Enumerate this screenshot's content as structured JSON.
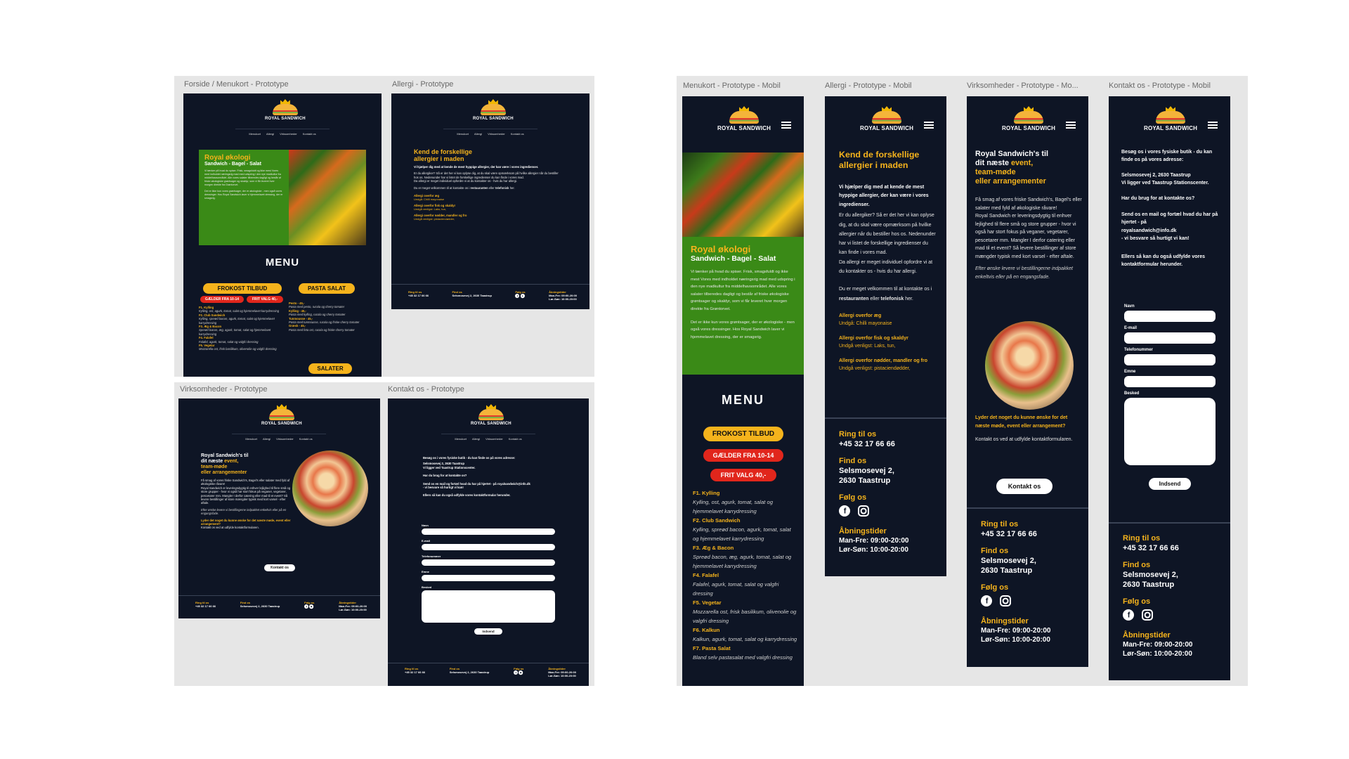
{
  "frames": {
    "desk_forside": "Forside / Menukort - Prototype",
    "desk_allergi": "Allergi - Prototype",
    "desk_virk": "Virksomheder - Prototype",
    "desk_kontakt": "Kontakt os - Prototype",
    "mob_menu": "Menukort - Prototype - Mobil",
    "mob_allergi": "Allergi - Prototype - Mobil",
    "mob_virk": "Virksomheder - Prototype - Mo...",
    "mob_kontakt": "Kontakt os - Prototype - Mobil"
  },
  "brand": {
    "name": "ROYAL SANDWICH",
    "tagline": "Taastrup"
  },
  "nav": [
    "Menukort",
    "Allergi",
    "Virksomheder",
    "Kontakt os"
  ],
  "hero": {
    "title": "Royal økologi",
    "subtitle": "Sandwich - Bagel - Salat",
    "p1": "Vi tænker på hvad du spiser. Frisk, smagsfuldt og ikke mest Vores med indholdet næringsrig mad med udspring i den nye madkultur fra middelhavsområdet. Alle vores salater tilberedes dagligt og består af friske økologiske grøntsager og skaldyr, som vi får leveret hver morgen direkte fra Grøntorvet.",
    "p2": "Det er ikke kun vores grøntsager, der er økologiske - men også vores dressinger. Hos Royal Sandwich laver vi hjemmelavet dressing, der er smagsrig."
  },
  "menu": {
    "title": "MENU",
    "breakfast": "FROKOST TILBUD",
    "valid": "GÆLDER FRA 10-14",
    "choice": "FRIT VALG 40,-",
    "pasta_btn": "PASTA SALAT",
    "salads_btn": "SALATER",
    "items": [
      {
        "name": "F1. Kylling",
        "desc": "Kylling, ost, agurk, tomat, salat og hjemmelavet karrydressing"
      },
      {
        "name": "F2. Club Sandwich",
        "desc": "Kylling, spreød bacon, agurk, tomat, salat og hjemmelavet karrydressing"
      },
      {
        "name": "F3. Æg & Bacon",
        "desc": "Spreød bacon, æg, agurk, tomat, salat og hjemmelavet karrydressing"
      },
      {
        "name": "F4. Falafel",
        "desc": "Falafel, agurk, tomat, salat og valgfri dressing"
      },
      {
        "name": "F5. Vegetar",
        "desc": "Mozzarella ost, frisk basilikum, olivenolie og valgfri dressing"
      },
      {
        "name": "F6. Kalkun",
        "desc": "Kalkun, agurk, tomat, salat og karrydressing"
      },
      {
        "name": "F7. Pasta Salat",
        "desc": "Bland selv pastasalat med valgfri dressing"
      }
    ],
    "pasta": [
      {
        "name": "Pesto - 45,-",
        "desc": "Pasta med pesto, rucola og cherry tomater"
      },
      {
        "name": "Kylling - 45,-",
        "desc": "Pasta med kylling, rucola og cherry tomater"
      },
      {
        "name": "Tunmousse - 45,-",
        "desc": "Pasta med tunmousse, rucola og friske cherry tomater"
      },
      {
        "name": "Græsk - 45,-",
        "desc": "Pasta med feta ost, rucola og friske cherry tomater"
      }
    ]
  },
  "allergi": {
    "title_a": "Kend de forskellige",
    "title_b": "allergier i maden",
    "lead": "Vi hjælper dig med at kende de mest hyppige allergier, der kan være i vores ingredienser.",
    "p1": "Er du allergiker? Så er det her vi kan oplyse dig, at du skal være opmærksom på hvilke allergier når du bestiller hos os. Nedenunder har vi listet de forskellige ingredienser du kan finde i vores mad.",
    "p2": "Da allergi er meget individuel opfordre vi at du kontakter os - hvis du har allergi.",
    "p3a": "Du er meget velkommen til at kontakte os i",
    "p3b": "restauranten",
    "p3c": "eller",
    "p3d": "telefonisk",
    "p3e": "her.",
    "items": [
      {
        "t": "Allergi overfor æg",
        "d": "Undgå: Chilli mayonaise"
      },
      {
        "t": "Allergi overfor fisk og skaldyr",
        "d": "Undgå venligst: Laks, tun,"
      },
      {
        "t": "Allergi overfor nødder, mandler og fro",
        "d": "Undgå venligst: pistaciendødder,"
      }
    ]
  },
  "virk": {
    "l1": "Royal Sandwich's til",
    "l2": "dit næste",
    "l2b": "event,",
    "l3": "team-møde",
    "l4": "eller arrangementer",
    "p1": "Få smag af vores friske Sandwich's, Bagel's eller salater med fyld af økologiske råvare!",
    "p2": "Royal Sandwich er leveringsdygtig til enhver lejlighed til flere små og store grupper - hvor vi også har stort fokus på veganer, vegetarer, pescetarer mm. Mangler I derfor catering eller mad til et event? Så levere bestillinger af store mængder typisk med kort varsel - efter aftale.",
    "p3": "Efter ønske levere vi bestillingerne indpakket enkeltvis eller på en engangsfade.",
    "q": "Lyder det noget du kunne ønske for det næste møde, event eller arrangement?",
    "p4": "Kontakt os ved at udfylde kontaktformularen.",
    "btn": "Kontakt os"
  },
  "kontakt": {
    "p1": "Besøg os i vores fysiske butik - du kan finde os på vores adresse:",
    "addr1": "Selsmosevej 2, 2630 Taastrup",
    "addr2": "Vi ligger ved Taastrup Stationscenter.",
    "q": "Har du brug for at kontakte os?",
    "mail1": "Send os en mail og fortæl hvad du har på hjertet - på",
    "mail2": "royalsandwich@info.dk",
    "mail3": "- vi besvare så hurtigt vi kan!",
    "form": "Ellers så kan du også udfylde vores kontaktformular herunder.",
    "name": "Navn",
    "email": "E-mail",
    "phone": "Telefonummer",
    "subject": "Emne",
    "msg": "Besked",
    "send": "Indsend"
  },
  "footer": {
    "ring": "Ring til os",
    "phone": "+45 32 17 66 66",
    "find": "Find os",
    "addr_a": "Selsmosevej 2,",
    "addr_b": "2630 Taastrup",
    "addr_full": "Selsmosevej 2, 2630 Taastrup",
    "follow": "Følg os",
    "hours": "Åbningstider",
    "h1": "Man-Fre: 09:00-20:00",
    "h2": "Lør-Søn: 10:00-20:00"
  }
}
